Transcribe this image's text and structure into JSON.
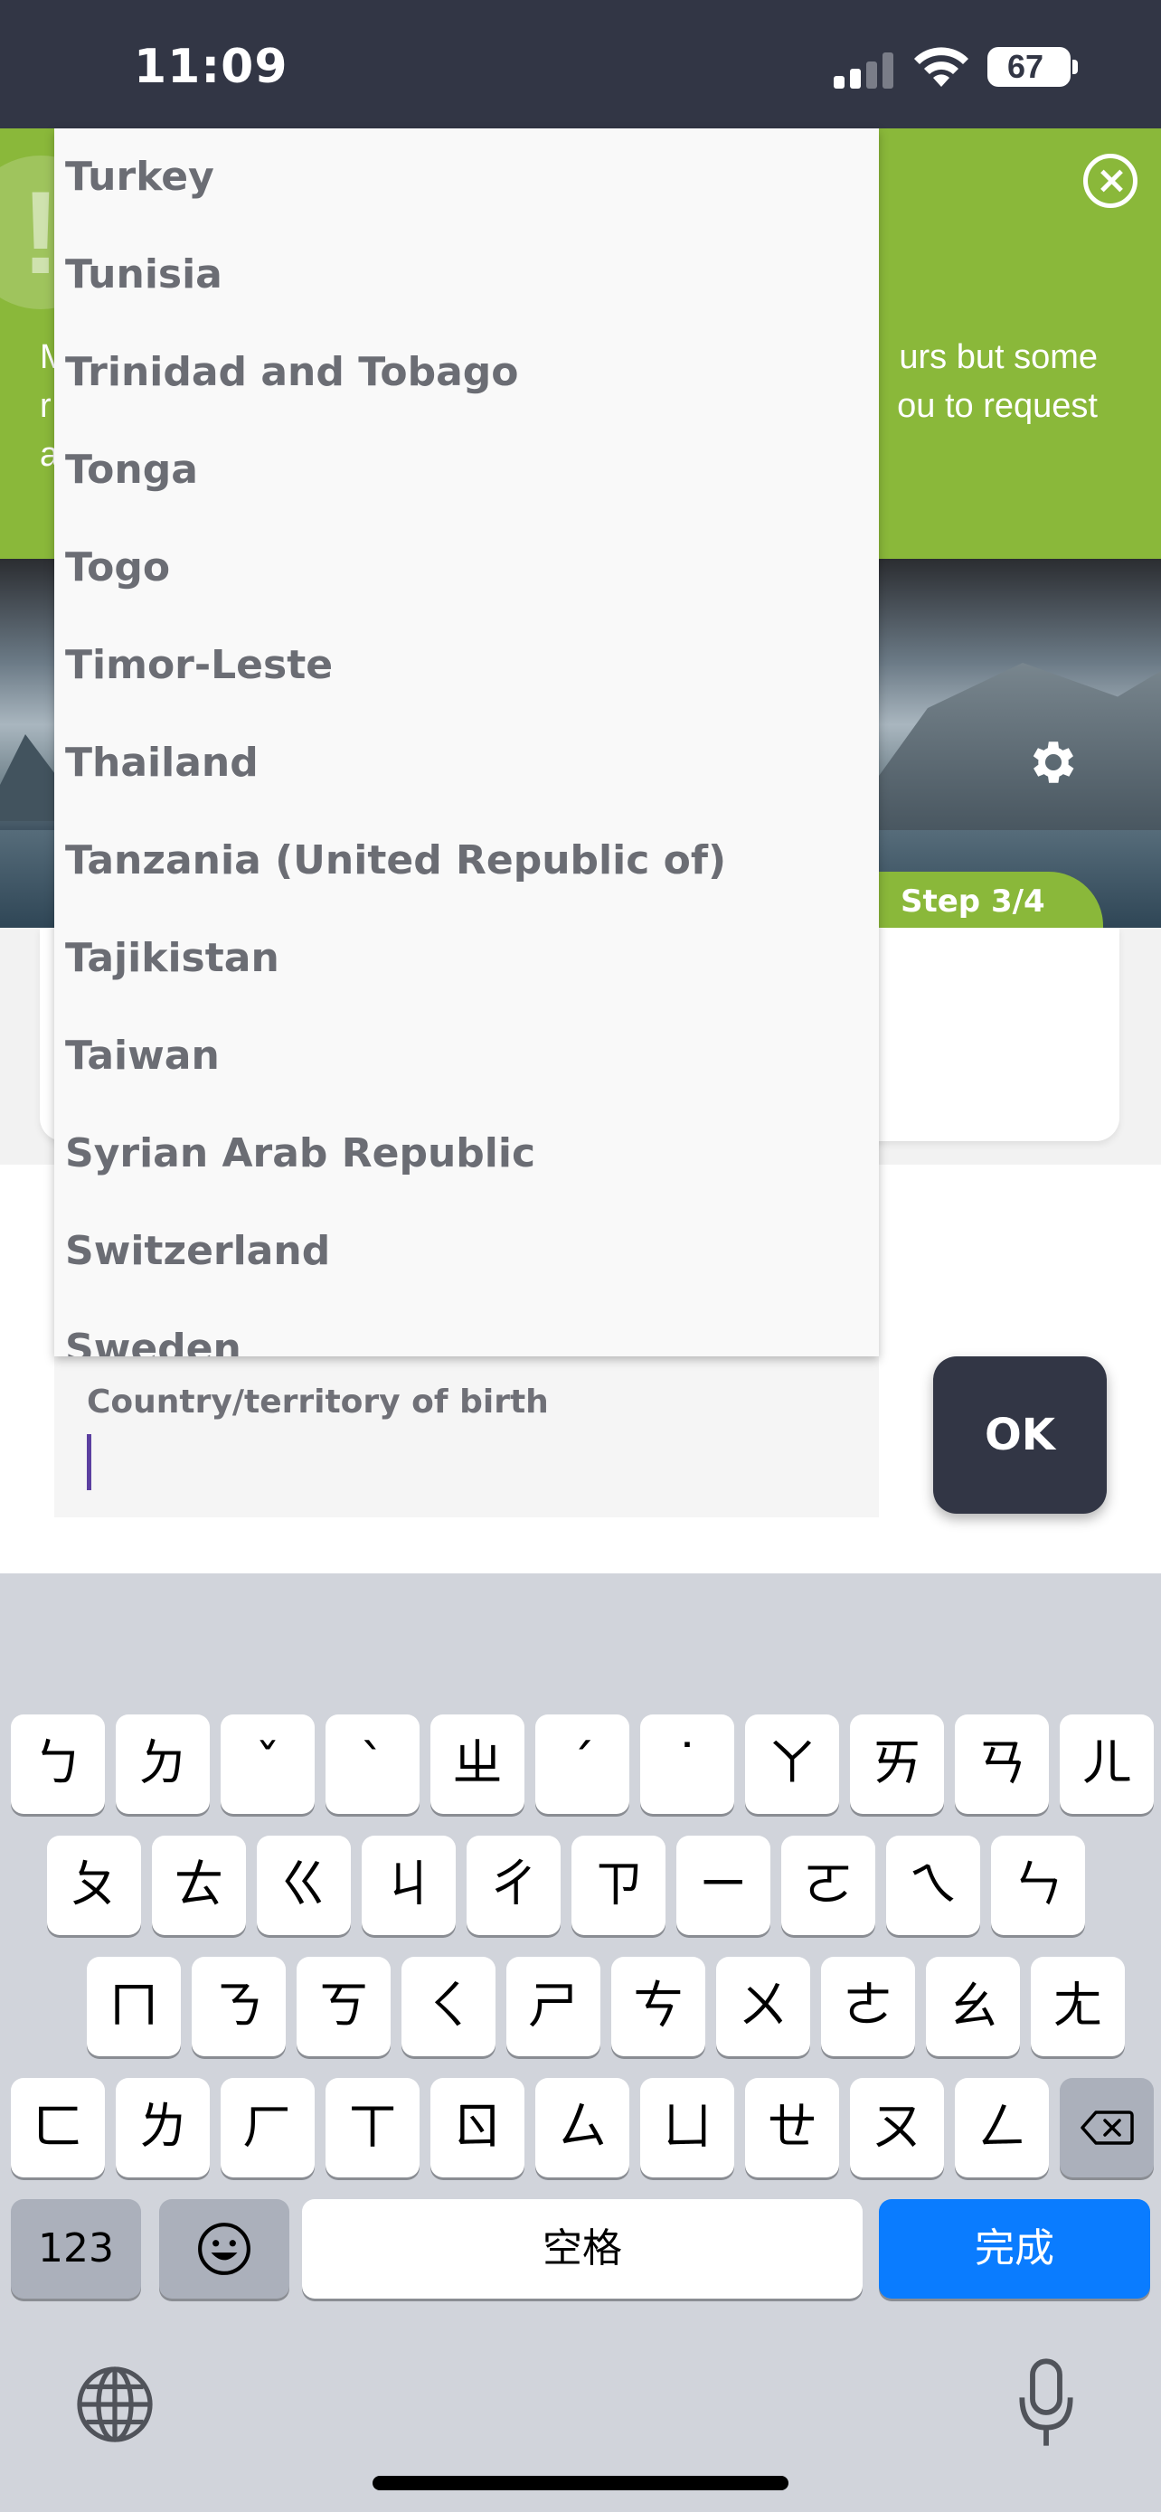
{
  "status_bar": {
    "time": "11:09",
    "battery": "67",
    "icons": [
      "cellular-signal-icon",
      "wifi-icon",
      "battery-icon"
    ]
  },
  "banner": {
    "text_visible": "M                                                                                       urs but some\nr                                                                                       ou to request\na",
    "color": "#8ab83a"
  },
  "header": {
    "step_label": "Step 3/4",
    "settings_icon": "gear-icon"
  },
  "dropdown": {
    "items": [
      "Turkey",
      "Tunisia",
      "Trinidad and Tobago",
      "Tonga",
      "Togo",
      "Timor-Leste",
      "Thailand",
      "Tanzania (United Republic of)",
      "Tajikistan",
      "Taiwan",
      "Syrian Arab Republic",
      "Switzerland",
      "Sweden"
    ]
  },
  "form": {
    "country_label": "Country/territory of birth",
    "country_value": "",
    "ok_label": "OK"
  },
  "keyboard": {
    "row1": [
      "ㄅ",
      "ㄉ",
      "ˇ",
      "ˋ",
      "ㄓ",
      "ˊ",
      "˙",
      "ㄚ",
      "ㄞ",
      "ㄢ",
      "ㄦ"
    ],
    "row2": [
      "ㄆ",
      "ㄊ",
      "ㄍ",
      "ㄐ",
      "ㄔ",
      "ㄗ",
      "ㄧ",
      "ㄛ",
      "ㄟ",
      "ㄣ"
    ],
    "row3": [
      "ㄇ",
      "ㄋ",
      "ㄎ",
      "ㄑ",
      "ㄕ",
      "ㄘ",
      "ㄨ",
      "ㄜ",
      "ㄠ",
      "ㄤ"
    ],
    "row4": [
      "ㄈ",
      "ㄌ",
      "ㄏ",
      "ㄒ",
      "ㄖ",
      "ㄙ",
      "ㄩ",
      "ㄝ",
      "ㄡ",
      "ㄥ"
    ],
    "numbers_label": "123",
    "space_label": "空格",
    "done_label": "完成",
    "done_color": "#0a7cff"
  }
}
